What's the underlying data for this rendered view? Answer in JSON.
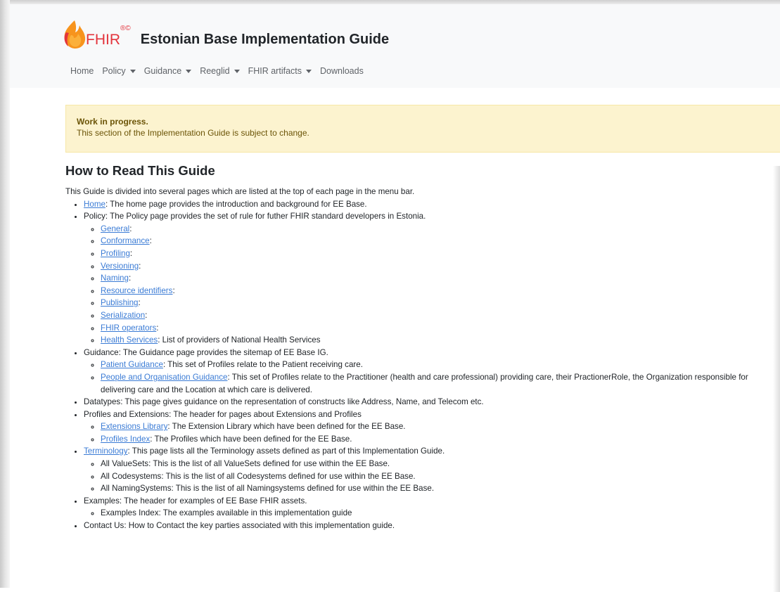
{
  "header": {
    "logo_text": "FHIR",
    "logo_mark": "®©",
    "site_title": "Estonian Base Implementation Guide"
  },
  "nav": [
    {
      "label": "Home",
      "dropdown": false
    },
    {
      "label": "Policy",
      "dropdown": true
    },
    {
      "label": "Guidance",
      "dropdown": true
    },
    {
      "label": "Reeglid",
      "dropdown": true
    },
    {
      "label": "FHIR artifacts",
      "dropdown": true
    },
    {
      "label": "Downloads",
      "dropdown": false
    }
  ],
  "alert": {
    "title": "Work in progress.",
    "body": "This section of the Implementation Guide is subject to change."
  },
  "heading": "How to Read This Guide",
  "intro": "This Guide is divided into several pages which are listed at the top of each page in the menu bar.",
  "items": [
    {
      "link": "Home",
      "text": ": The home page provides the introduction and background for EE Base.",
      "sub": []
    },
    {
      "link": "",
      "text": "Policy: The Policy page provides the set of rule for futher FHIR standard developers in Estonia.",
      "sub": [
        {
          "link": "General",
          "text": ":"
        },
        {
          "link": "Conformance",
          "text": ":"
        },
        {
          "link": "Profiling",
          "text": ":"
        },
        {
          "link": "Versioning",
          "text": ":"
        },
        {
          "link": "Naming",
          "text": ":"
        },
        {
          "link": "Resource identifiers",
          "text": ":"
        },
        {
          "link": "Publishing",
          "text": ":"
        },
        {
          "link": "Serialization",
          "text": ":"
        },
        {
          "link": "FHIR operators",
          "text": ":"
        },
        {
          "link": "Health Services",
          "text": ": List of providers of National Health Services"
        }
      ]
    },
    {
      "link": "",
      "text": "Guidance: The Guidance page provides the sitemap of EE Base IG.",
      "sub": [
        {
          "link": "Patient Guidance",
          "text": ": This set of Profiles relate to the Patient receiving care."
        },
        {
          "link": "People and Organisation Guidance",
          "text": ": This set of Profiles relate to the Practitioner (health and care professional) providing care, their PractionerRole, the Organization responsible for delivering care and the Location at which care is delivered."
        }
      ]
    },
    {
      "link": "",
      "text": "Datatypes: This page gives guidance on the representation of constructs like Address, Name, and Telecom etc.",
      "sub": []
    },
    {
      "link": "",
      "text": "Profiles and Extensions: The header for pages about Extensions and Profiles",
      "sub": [
        {
          "link": "Extensions Library",
          "text": ": The Extension Library which have been defined for the EE Base."
        },
        {
          "link": "Profiles Index",
          "text": ": The Profiles which have been defined for the EE Base."
        }
      ]
    },
    {
      "link": "Terminology",
      "text": ": This page lists all the Terminology assets defined as part of this Implementation Guide.",
      "sub": [
        {
          "link": "",
          "text": "All ValueSets: This is the list of all ValueSets defined for use within the EE Base."
        },
        {
          "link": "",
          "text": "All Codesystems: This is the list of all Codesystems defined for use within the EE Base."
        },
        {
          "link": "",
          "text": "All NamingSystems: This is the list of all Namingsystems defined for use within the EE Base."
        }
      ]
    },
    {
      "link": "",
      "text": "Examples: The header for examples of EE Base FHIR assets.",
      "sub": [
        {
          "link": "",
          "text": "Examples Index: The examples available in this implementation guide"
        }
      ]
    },
    {
      "link": "",
      "text": "Contact Us: How to Contact the key parties associated with this implementation guide.",
      "sub": []
    }
  ],
  "colors": {
    "navbar_bg": "#f8f9fa",
    "alert_bg": "#fcf3cf",
    "link": "#3a7bd5",
    "logo": "#e3343c"
  }
}
